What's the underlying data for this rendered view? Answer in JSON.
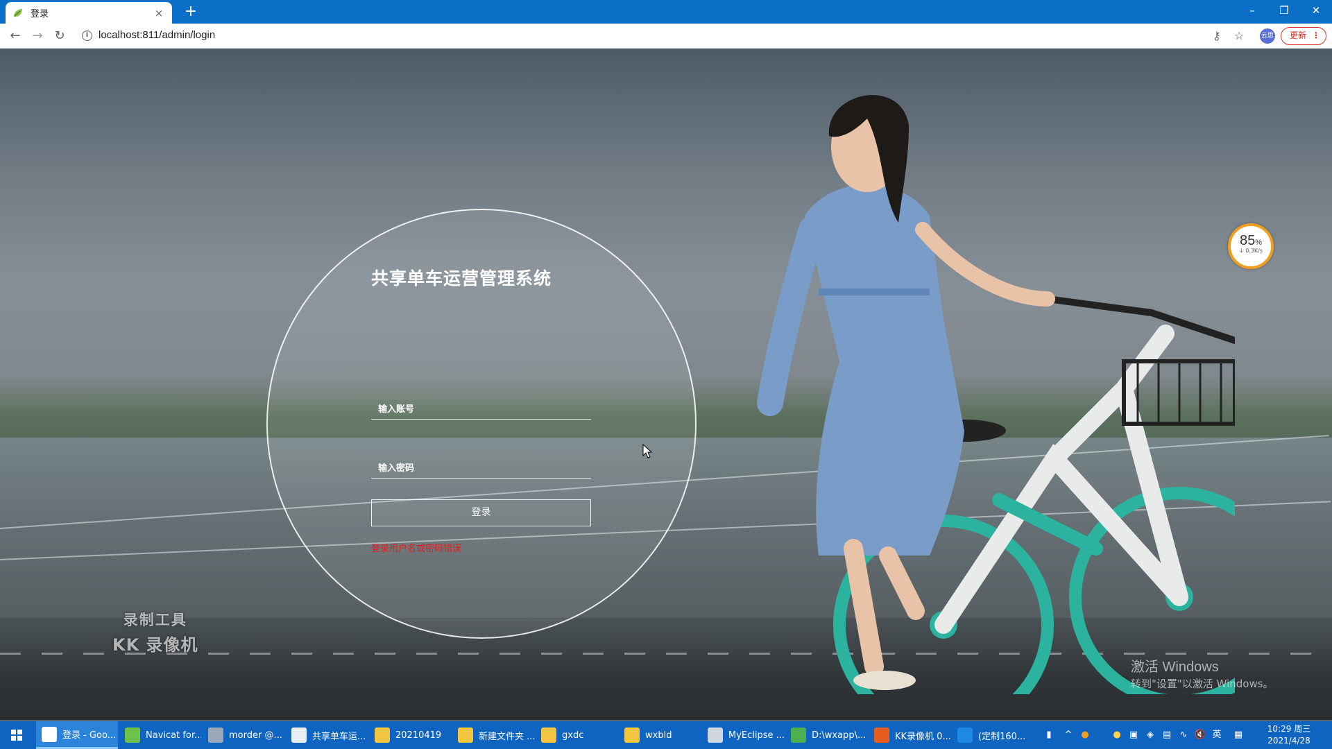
{
  "browser": {
    "tab_title": "登录",
    "tab_close": "×",
    "new_tab": "+",
    "url": "localhost:811/admin/login",
    "update_label": "更新",
    "profile_label": "云思",
    "window_controls": {
      "minimize": "–",
      "restore": "❐",
      "close": "✕"
    }
  },
  "login": {
    "title": "共享单车运营管理系统",
    "account_placeholder": "输入账号",
    "password_placeholder": "输入密码",
    "login_button": "登录",
    "error_message": "登录用户名或密码错误"
  },
  "overlays": {
    "recorder_line1": "录制工具",
    "recorder_line2": "KK 录像机",
    "activate_line1": "激活 Windows",
    "activate_line2": "转到\"设置\"以激活 Windows。",
    "speed_percent": "85",
    "speed_unit": "%",
    "speed_rate": "↓ 0.3K/s"
  },
  "taskbar": {
    "items": [
      {
        "label": "登录 - Goo...",
        "icon": "chrome-icon",
        "color": "#ffffff"
      },
      {
        "label": "Navicat for...",
        "icon": "navicat-icon",
        "color": "#6cc24a"
      },
      {
        "label": "morder @...",
        "icon": "database-icon",
        "color": "#9aa8b8"
      },
      {
        "label": "共享单车运...",
        "icon": "wechat-devtools-icon",
        "color": "#e8eef5"
      },
      {
        "label": "20210419",
        "icon": "folder-icon",
        "color": "#f5c542"
      },
      {
        "label": "新建文件夹 ...",
        "icon": "folder-icon",
        "color": "#f5c542"
      },
      {
        "label": "gxdc",
        "icon": "folder-icon",
        "color": "#f5c542"
      },
      {
        "label": "wxbld",
        "icon": "folder-icon",
        "color": "#f5c542"
      },
      {
        "label": "MyEclipse ...",
        "icon": "myeclipse-icon",
        "color": "#d0d6e0"
      },
      {
        "label": "D:\\wxapp\\...",
        "icon": "notepad-icon",
        "color": "#4caf50"
      },
      {
        "label": "KK录像机 0...",
        "icon": "kk-recorder-icon",
        "color": "#e65c1c"
      },
      {
        "label": "(定制160...",
        "icon": "vpn-icon",
        "color": "#1e88e5"
      }
    ],
    "ime_label": "英",
    "time": "10:29 周三",
    "date": "2021/4/28"
  }
}
